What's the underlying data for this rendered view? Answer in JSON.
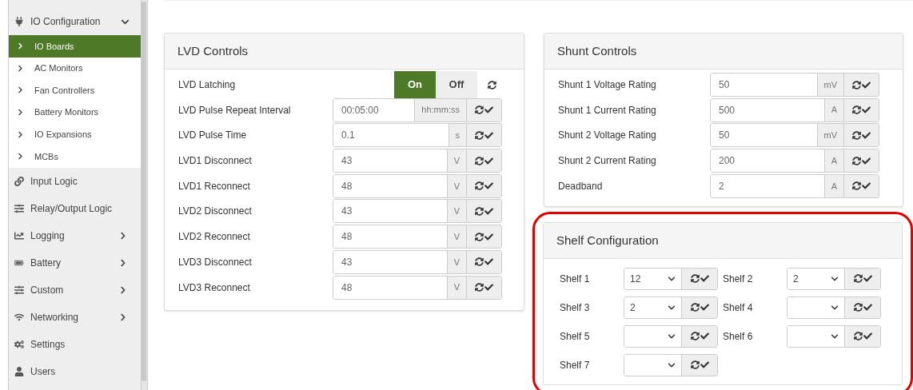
{
  "sidebar": {
    "items": [
      {
        "label": "IO Configuration",
        "kind": "group",
        "expanded": true,
        "children": [
          {
            "label": "IO Boards",
            "selected": true
          },
          {
            "label": "AC Monitors",
            "selected": false
          },
          {
            "label": "Fan Controllers",
            "selected": false
          },
          {
            "label": "Battery Monitors",
            "selected": false
          },
          {
            "label": "IO Expansions",
            "selected": false
          },
          {
            "label": "MCBs",
            "selected": false
          }
        ]
      },
      {
        "label": "Input Logic",
        "kind": "link"
      },
      {
        "label": "Relay/Output Logic",
        "kind": "link"
      },
      {
        "label": "Logging",
        "kind": "group",
        "expanded": false
      },
      {
        "label": "Battery",
        "kind": "group",
        "expanded": false
      },
      {
        "label": "Custom",
        "kind": "group",
        "expanded": false
      },
      {
        "label": "Networking",
        "kind": "group",
        "expanded": false
      },
      {
        "label": "Settings",
        "kind": "link"
      },
      {
        "label": "Users",
        "kind": "link"
      }
    ]
  },
  "lvd_controls": {
    "title": "LVD Controls",
    "rows": [
      {
        "kind": "toggle",
        "label": "LVD Latching",
        "options": [
          {
            "label": "On",
            "selected": true
          },
          {
            "label": "Off",
            "selected": false
          }
        ]
      },
      {
        "kind": "input",
        "label": "LVD Pulse Repeat Interval",
        "value": "00:05:00",
        "unit": "hh:mm:ss"
      },
      {
        "kind": "input",
        "label": "LVD Pulse Time",
        "value": "0.1",
        "unit": "s"
      },
      {
        "kind": "input",
        "label": "LVD1 Disconnect",
        "value": "43",
        "unit": "V"
      },
      {
        "kind": "input",
        "label": "LVD1 Reconnect",
        "value": "48",
        "unit": "V"
      },
      {
        "kind": "input",
        "label": "LVD2 Disconnect",
        "value": "43",
        "unit": "V"
      },
      {
        "kind": "input",
        "label": "LVD2 Reconnect",
        "value": "48",
        "unit": "V"
      },
      {
        "kind": "input",
        "label": "LVD3 Disconnect",
        "value": "43",
        "unit": "V"
      },
      {
        "kind": "input",
        "label": "LVD3 Reconnect",
        "value": "48",
        "unit": "V"
      }
    ]
  },
  "shunt_controls": {
    "title": "Shunt Controls",
    "rows": [
      {
        "label": "Shunt 1 Voltage Rating",
        "value": "50",
        "unit": "mV"
      },
      {
        "label": "Shunt 1 Current Rating",
        "value": "500",
        "unit": "A"
      },
      {
        "label": "Shunt 2 Voltage Rating",
        "value": "50",
        "unit": "mV"
      },
      {
        "label": "Shunt 2 Current Rating",
        "value": "200",
        "unit": "A"
      },
      {
        "label": "Deadband",
        "value": "2",
        "unit": "A"
      }
    ]
  },
  "shelf_configuration": {
    "title": "Shelf Configuration",
    "highlighted": true,
    "shelves": [
      {
        "label": "Shelf 1",
        "value": "12"
      },
      {
        "label": "Shelf 2",
        "value": "2"
      },
      {
        "label": "Shelf 3",
        "value": "2"
      },
      {
        "label": "Shelf 4"
      },
      {
        "label": "Shelf 5"
      },
      {
        "label": "Shelf 6"
      },
      {
        "label": "Shelf 7"
      }
    ]
  }
}
